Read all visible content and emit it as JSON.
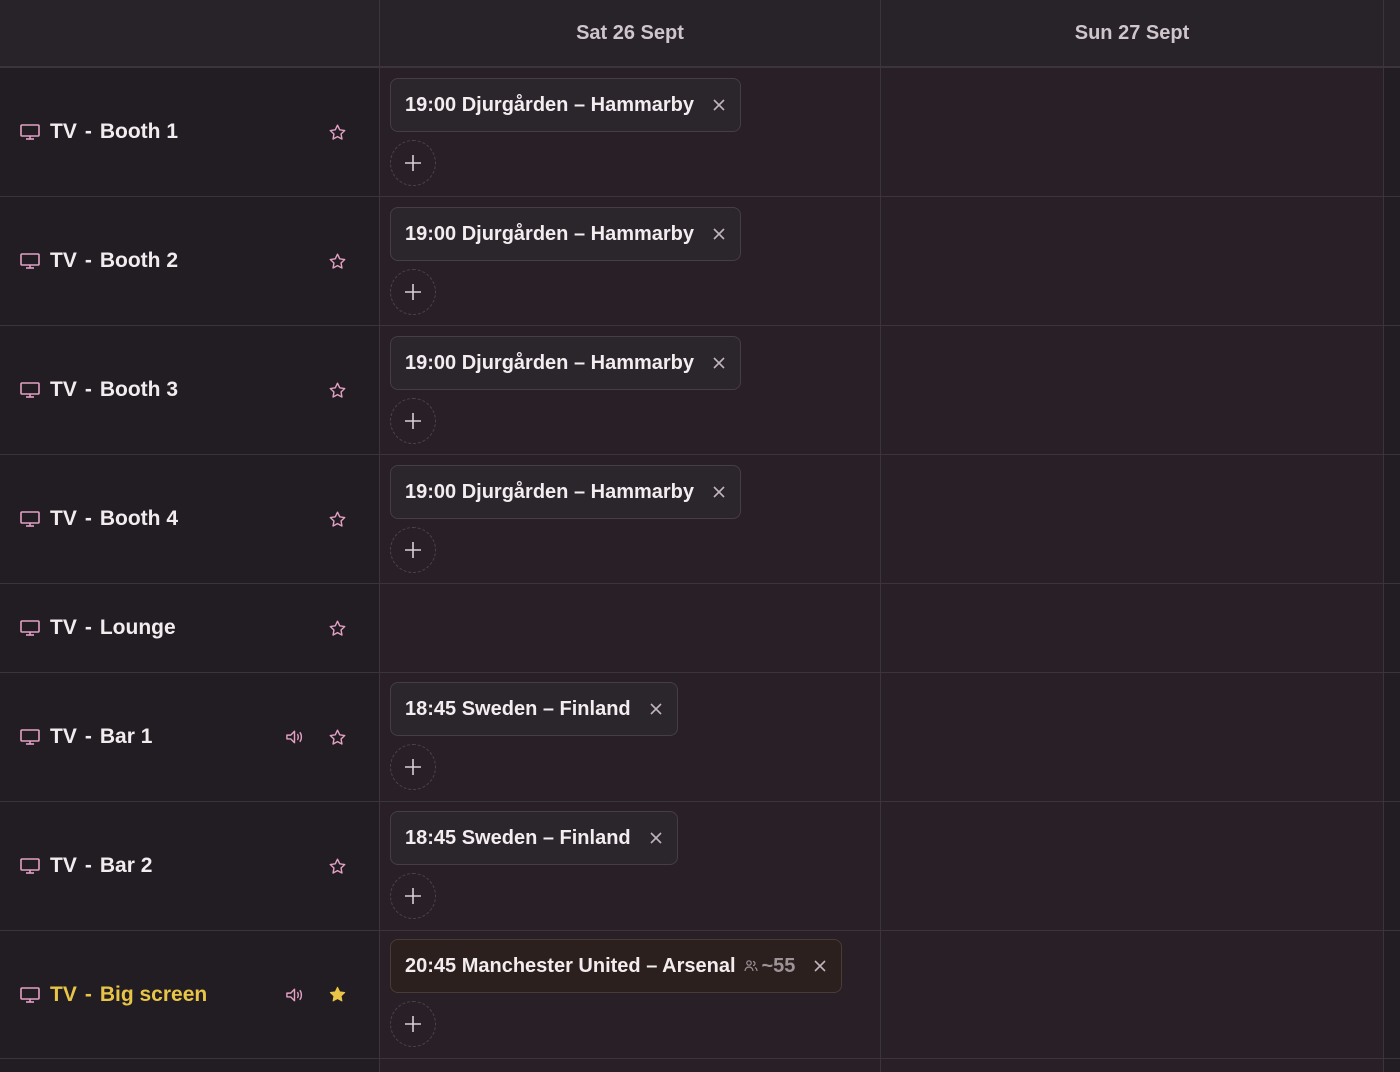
{
  "days": [
    "Sat 26 Sept",
    "Sun 27 Sept"
  ],
  "rows": [
    {
      "tv": "TV",
      "dash": "-",
      "name": "Booth 1",
      "event": "19:00 Djurgården – Hammarby"
    },
    {
      "tv": "TV",
      "dash": "-",
      "name": "Booth 2",
      "event": "19:00 Djurgården – Hammarby"
    },
    {
      "tv": "TV",
      "dash": "-",
      "name": "Booth 3",
      "event": "19:00 Djurgården – Hammarby"
    },
    {
      "tv": "TV",
      "dash": "-",
      "name": "Booth 4",
      "event": "19:00 Djurgården – Hammarby"
    },
    {
      "tv": "TV",
      "dash": "-",
      "name": "Lounge"
    },
    {
      "tv": "TV",
      "dash": "-",
      "name": "Bar 1",
      "event": "18:45 Sweden – Finland",
      "sound": true
    },
    {
      "tv": "TV",
      "dash": "-",
      "name": "Bar 2",
      "event": "18:45 Sweden – Finland"
    },
    {
      "tv": "TV",
      "dash": "-",
      "name": "Big screen",
      "event": "20:45 Manchester United – Arsenal",
      "attendees": "~55",
      "sound": true,
      "highlight": true
    }
  ],
  "icons": {
    "tv": "monitor-icon",
    "favorite": "star-icon",
    "sound": "speaker-icon",
    "remove": "close-icon",
    "add": "plus-icon",
    "attendees": "people-icon"
  },
  "colors": {
    "highlight": "#e8c547",
    "icon_accent": "#e2a0c4"
  }
}
